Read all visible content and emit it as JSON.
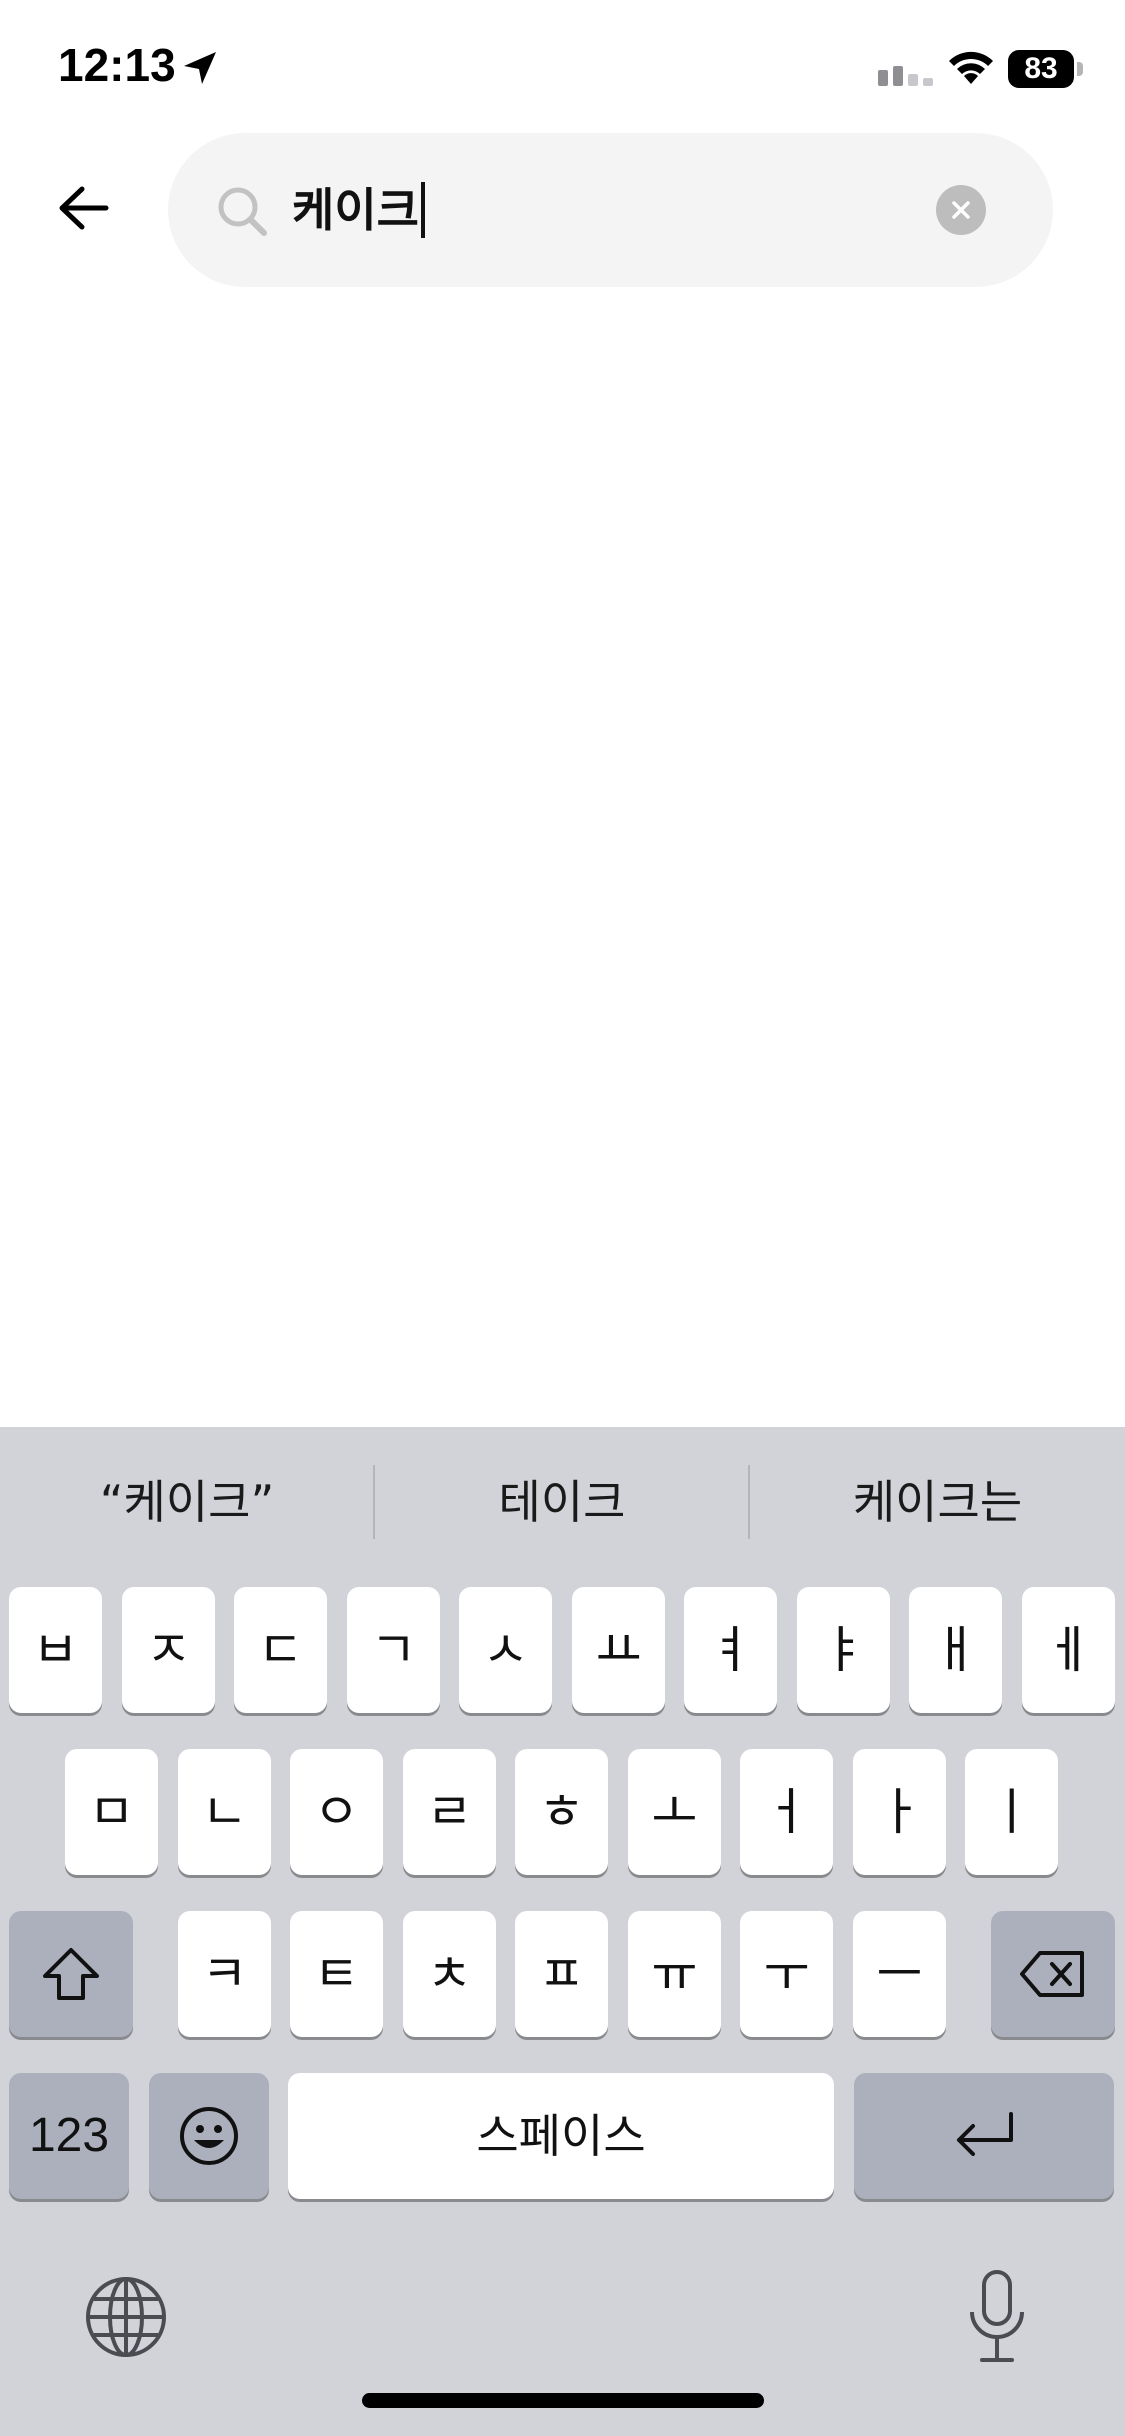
{
  "status_bar": {
    "time": "12:13",
    "battery_level": "83"
  },
  "search": {
    "query": "케이크"
  },
  "keyboard": {
    "suggestions": [
      "“케이크”",
      "테이크",
      "케이크는"
    ],
    "row1": [
      "ㅂ",
      "ㅈ",
      "ㄷ",
      "ㄱ",
      "ㅅ",
      "ㅛ",
      "ㅕ",
      "ㅑ",
      "ㅐ",
      "ㅔ"
    ],
    "row2": [
      "ㅁ",
      "ㄴ",
      "ㅇ",
      "ㄹ",
      "ㅎ",
      "ㅗ",
      "ㅓ",
      "ㅏ",
      "ㅣ"
    ],
    "row3": [
      "ㅋ",
      "ㅌ",
      "ㅊ",
      "ㅍ",
      "ㅠ",
      "ㅜ",
      "ㅡ"
    ],
    "numbers_label": "123",
    "space_label": "스페이스"
  },
  "icons": {
    "location": "location-arrow-icon",
    "signal": "cellular-signal-icon",
    "wifi": "wifi-icon",
    "back": "arrow-left-icon",
    "search": "magnifier-icon",
    "clear": "clear-x-icon",
    "shift": "shift-arrow-icon",
    "delete": "backspace-icon",
    "emoji": "smiley-icon",
    "return": "return-arrow-icon",
    "globe": "globe-icon",
    "mic": "microphone-icon"
  },
  "colors": {
    "search_background": "#f4f4f4",
    "keyboard_background": "#d1d3d9",
    "key_background": "#ffffff",
    "function_key_background": "#abb0bc"
  }
}
